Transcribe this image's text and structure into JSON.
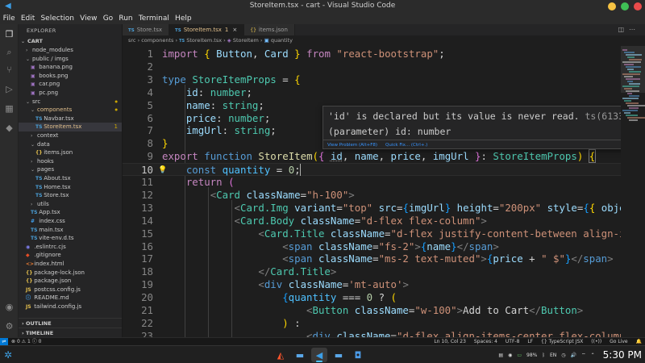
{
  "window": {
    "title": "StoreItem.tsx - cart - Visual Studio Code"
  },
  "menu": [
    "File",
    "Edit",
    "Selection",
    "View",
    "Go",
    "Run",
    "Terminal",
    "Help"
  ],
  "sidebar": {
    "header": "EXPLORER",
    "root": "CART",
    "items": [
      {
        "label": "node_modules",
        "depth": 1,
        "kind": "folder",
        "open": false
      },
      {
        "label": "public / imgs",
        "depth": 1,
        "kind": "folder",
        "open": true
      },
      {
        "label": "banana.png",
        "depth": 2,
        "kind": "img"
      },
      {
        "label": "books.png",
        "depth": 2,
        "kind": "img"
      },
      {
        "label": "car.png",
        "depth": 2,
        "kind": "img"
      },
      {
        "label": "pc.png",
        "depth": 2,
        "kind": "img"
      },
      {
        "label": "src",
        "depth": 1,
        "kind": "folder",
        "open": true,
        "dot": true
      },
      {
        "label": "components",
        "depth": 2,
        "kind": "folder",
        "open": true,
        "dot": true,
        "color": "#e2c08d"
      },
      {
        "label": "Navbar.tsx",
        "depth": 3,
        "kind": "ts"
      },
      {
        "label": "StoreItem.tsx",
        "depth": 3,
        "kind": "ts",
        "selected": true,
        "badge": "1",
        "color": "#e2c08d"
      },
      {
        "label": "context",
        "depth": 2,
        "kind": "folder",
        "open": false
      },
      {
        "label": "data",
        "depth": 2,
        "kind": "folder",
        "open": true
      },
      {
        "label": "items.json",
        "depth": 3,
        "kind": "json"
      },
      {
        "label": "hooks",
        "depth": 2,
        "kind": "folder",
        "open": false
      },
      {
        "label": "pages",
        "depth": 2,
        "kind": "folder",
        "open": true
      },
      {
        "label": "About.tsx",
        "depth": 3,
        "kind": "ts"
      },
      {
        "label": "Home.tsx",
        "depth": 3,
        "kind": "ts"
      },
      {
        "label": "Store.tsx",
        "depth": 3,
        "kind": "ts"
      },
      {
        "label": "utils",
        "depth": 2,
        "kind": "folder",
        "open": false
      },
      {
        "label": "App.tsx",
        "depth": 2,
        "kind": "ts"
      },
      {
        "label": "index.css",
        "depth": 2,
        "kind": "css"
      },
      {
        "label": "main.tsx",
        "depth": 2,
        "kind": "ts"
      },
      {
        "label": "vite-env.d.ts",
        "depth": 2,
        "kind": "ts"
      },
      {
        "label": ".eslintrc.cjs",
        "depth": 1,
        "kind": "eslint"
      },
      {
        "label": ".gitignore",
        "depth": 1,
        "kind": "git"
      },
      {
        "label": "index.html",
        "depth": 1,
        "kind": "html"
      },
      {
        "label": "package-lock.json",
        "depth": 1,
        "kind": "json"
      },
      {
        "label": "package.json",
        "depth": 1,
        "kind": "json"
      },
      {
        "label": "postcss.config.js",
        "depth": 1,
        "kind": "js"
      },
      {
        "label": "README.md",
        "depth": 1,
        "kind": "md"
      },
      {
        "label": "tailwind.config.js",
        "depth": 1,
        "kind": "js"
      }
    ],
    "sections": [
      "OUTLINE",
      "TIMELINE"
    ]
  },
  "tabs": [
    {
      "label": "Store.tsx",
      "icon": "TS",
      "active": false
    },
    {
      "label": "StoreItem.tsx",
      "icon": "TS",
      "active": true,
      "modified": "1"
    },
    {
      "label": "items.json",
      "icon": "{}",
      "active": false
    }
  ],
  "breadcrumb": [
    "src",
    "components",
    "StoreItem.tsx",
    "StoreItem",
    "quantity"
  ],
  "current_line": 10,
  "code": [
    {
      "n": "1"
    },
    {
      "n": "2"
    },
    {
      "n": "3"
    },
    {
      "n": "4"
    },
    {
      "n": "5"
    },
    {
      "n": "6"
    },
    {
      "n": "7"
    },
    {
      "n": "8"
    },
    {
      "n": "9"
    },
    {
      "n": "10"
    },
    {
      "n": "11"
    },
    {
      "n": "12"
    },
    {
      "n": "13"
    },
    {
      "n": "14"
    },
    {
      "n": "15"
    },
    {
      "n": "16"
    },
    {
      "n": "17"
    },
    {
      "n": "18"
    },
    {
      "n": "19"
    },
    {
      "n": "20"
    },
    {
      "n": "21"
    },
    {
      "n": "22"
    },
    {
      "n": "23"
    }
  ],
  "hover": {
    "message": "'id' is declared but its value is never read.",
    "code_ref": "ts(6133)",
    "signature": "(parameter) id: number",
    "actions": [
      "View Problem (Alt+F8)",
      "Quick Fix... (Ctrl+.)"
    ]
  },
  "status": {
    "errors": "0",
    "warnings": "1",
    "info": "0",
    "position": "Ln 10, Col 23",
    "spaces": "Spaces: 4",
    "encoding": "UTF-8",
    "eol": "LF",
    "language": "{} TypeScript JSX",
    "golive": "Go Live"
  },
  "taskbar": {
    "battery": "98%",
    "lang": "EN",
    "time": "5:30 PM"
  },
  "colors": {
    "accent": "#0078d4",
    "modified": "#e2c08d",
    "warning": "#cca700"
  }
}
